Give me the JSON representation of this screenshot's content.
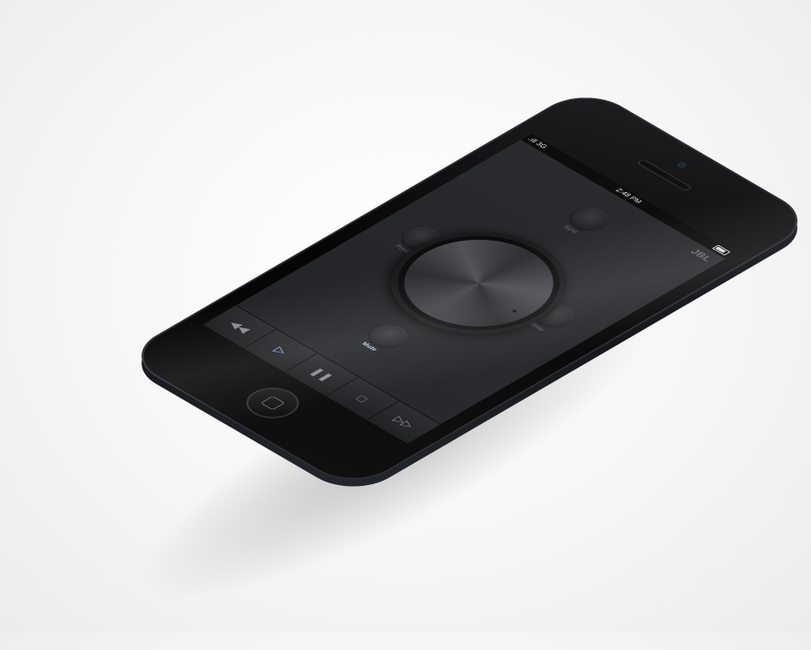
{
  "status_bar": {
    "signal": ".ıll",
    "network": "3G",
    "time": "2:48 PM"
  },
  "brand": "JBL",
  "buttons": {
    "sync": "Sync",
    "menu": "Menu",
    "func": "Func",
    "mute": "Mute"
  },
  "transport": {
    "rewind": "rewind-icon",
    "play": "play-icon",
    "pause": "pause-icon",
    "stop": "stop-icon",
    "forward": "fast-forward-icon"
  },
  "colors": {
    "accent": "#9fc3ff",
    "phone_body": "#0b0b0c"
  }
}
